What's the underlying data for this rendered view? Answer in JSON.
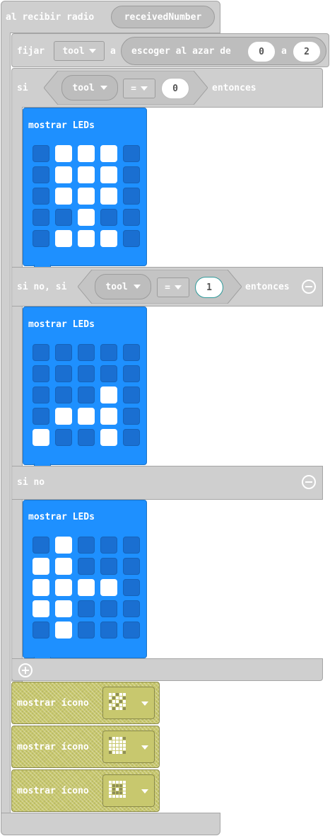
{
  "event_block": {
    "label": "al recibir radio",
    "param": "receivedNumber"
  },
  "set_block": {
    "label": "fijar",
    "variable": "tool",
    "to_label": "a",
    "random_label": "escoger al azar de",
    "from_value": "0",
    "and_label": "a",
    "to_value": "2"
  },
  "if_block": {
    "if_label": "si",
    "variable": "tool",
    "operator": "=",
    "value": "0",
    "then_label": "entonces",
    "elseif_label": "si no, si",
    "elseif_variable": "tool",
    "elseif_operator": "=",
    "elseif_value": "1",
    "elseif_then_label": "entonces",
    "else_label": "si no"
  },
  "led_blocks": [
    {
      "label": "mostrar LEDs",
      "grid": [
        [
          0,
          1,
          1,
          1,
          0
        ],
        [
          0,
          1,
          1,
          1,
          0
        ],
        [
          0,
          1,
          1,
          1,
          0
        ],
        [
          0,
          0,
          1,
          0,
          0
        ],
        [
          0,
          1,
          1,
          1,
          0
        ]
      ]
    },
    {
      "label": "mostrar LEDs",
      "grid": [
        [
          0,
          0,
          0,
          0,
          0
        ],
        [
          0,
          0,
          0,
          0,
          0
        ],
        [
          0,
          0,
          0,
          1,
          0
        ],
        [
          0,
          1,
          1,
          1,
          0
        ],
        [
          1,
          0,
          0,
          1,
          0
        ]
      ]
    },
    {
      "label": "mostrar LEDs",
      "grid": [
        [
          0,
          1,
          0,
          0,
          0
        ],
        [
          1,
          1,
          0,
          0,
          0
        ],
        [
          1,
          1,
          1,
          1,
          0
        ],
        [
          1,
          1,
          0,
          0,
          0
        ],
        [
          0,
          1,
          0,
          0,
          0
        ]
      ]
    }
  ],
  "icon_blocks": [
    {
      "label": "mostrar ícono",
      "grid": [
        [
          1,
          1,
          0,
          1,
          1
        ],
        [
          1,
          0,
          1,
          1,
          0
        ],
        [
          0,
          1,
          1,
          0,
          1
        ],
        [
          1,
          1,
          0,
          1,
          1
        ],
        [
          1,
          0,
          1,
          1,
          0
        ]
      ]
    },
    {
      "label": "mostrar ícono",
      "grid": [
        [
          0,
          1,
          1,
          1,
          0
        ],
        [
          1,
          1,
          1,
          1,
          1
        ],
        [
          1,
          1,
          1,
          1,
          1
        ],
        [
          1,
          1,
          1,
          1,
          1
        ],
        [
          0,
          1,
          1,
          1,
          0
        ]
      ]
    },
    {
      "label": "mostrar ícono",
      "grid": [
        [
          1,
          1,
          1,
          1,
          1
        ],
        [
          1,
          0,
          0,
          0,
          1
        ],
        [
          1,
          0,
          1,
          0,
          1
        ],
        [
          1,
          0,
          0,
          0,
          1
        ],
        [
          1,
          1,
          1,
          1,
          1
        ]
      ]
    }
  ],
  "colors": {
    "control_grey": "#cfcfcf",
    "led_block_blue": "#1e90ff",
    "led_off": "#1a6fd1",
    "led_on": "#ffffff",
    "icon_block_olive": "#c8c86e"
  }
}
